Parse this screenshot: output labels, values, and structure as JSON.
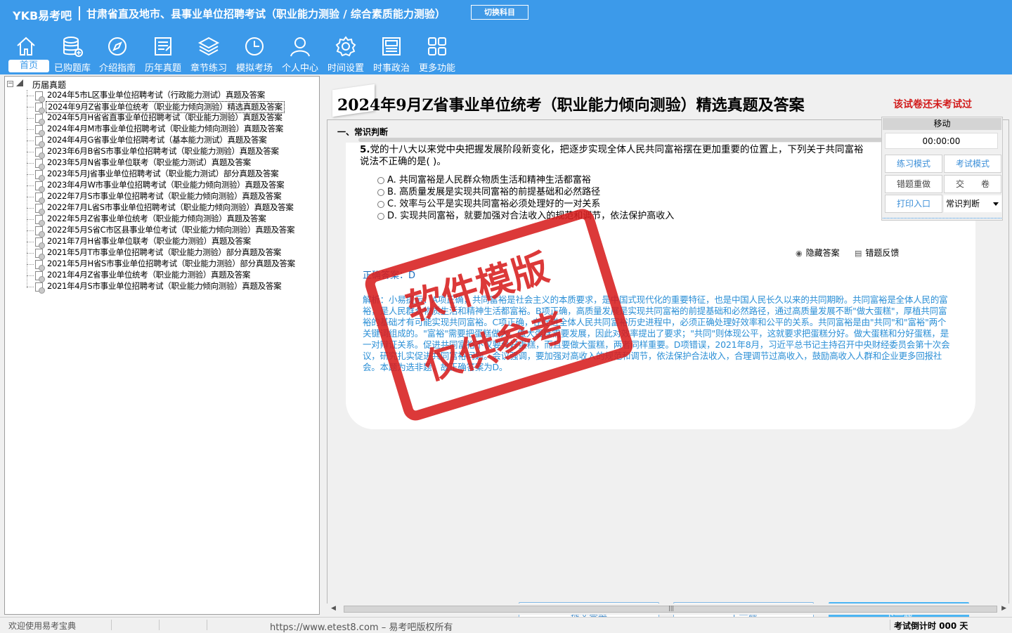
{
  "header": {
    "logo": "YKB易考吧",
    "title": "甘肃省直及地市、县事业单位招聘考试（职业能力测验 / 综合素质能力测验）",
    "switch_label": "切换科目"
  },
  "nav": [
    {
      "label": "首页",
      "icon": "home-icon",
      "active": true
    },
    {
      "label": "已购题库",
      "icon": "database-icon"
    },
    {
      "label": "介绍指南",
      "icon": "compass-icon"
    },
    {
      "label": "历年真题",
      "icon": "document-icon"
    },
    {
      "label": "章节练习",
      "icon": "layers-icon"
    },
    {
      "label": "模拟考场",
      "icon": "clock-icon"
    },
    {
      "label": "个人中心",
      "icon": "user-icon"
    },
    {
      "label": "时间设置",
      "icon": "gear-icon"
    },
    {
      "label": "时事政治",
      "icon": "newspaper-icon"
    },
    {
      "label": "更多功能",
      "icon": "grid-icon"
    }
  ],
  "tree": {
    "root": "历届真题",
    "items": [
      "2024年5市L区事业单位招聘考试（行政能力测试）真题及答案",
      "2024年9月Z省事业单位统考（职业能力倾向测验）精选真题及答案",
      "2024年5月H省省直事业单位招聘考试（职业能力测验）真题及答案",
      "2024年4月M市事业单位招聘考试（职业能力倾向测验）真题及答案",
      "2024年4月G省事业单位招聘考试（基本能力测试）真题及答案",
      "2023年6月B省S市事业单位招聘考试（职业能力测验）真题及答案",
      "2023年5月N省事业单位联考（职业能力测试）真题及答案",
      "2023年5月J省事业单位招聘考试（职业能力测试）部分真题及答案",
      "2023年4月W市事业单位招聘考试（职业能力倾向测验）真题及答案",
      "2022年7月S市事业单位招聘考试（职业能力倾向测验）真题及答案",
      "2022年7月L省S市事业单位招聘考试（职业能力倾向测验）真题及答案",
      "2022年5月Z省事业单位统考（职业能力倾向测验）真题及答案",
      "2022年5月S省C市区县事业单位考试（职业能力倾向测验）真题及答案",
      "2021年7月H省事业单位联考（职业能力测验）真题及答案",
      "2021年5月T市事业单位招聘考试（职业能力测验）部分真题及答案",
      "2021年5月H省S市事业单位招聘考试（职业能力测验）部分真题及答案",
      "2021年4月Z省事业单位统考（职业能力测验）真题及答案",
      "2021年4月S市事业单位招聘考试（职业能力倾向测验）真题及答案"
    ],
    "selected_index": 1
  },
  "exam": {
    "title": "2024年9月Z省事业单位统考（职业能力倾向测验）精选真题及答案",
    "status": "该试卷还未考试过",
    "section": "一、常识判断",
    "question_number": "5.",
    "question_text": "党的十八大以来党中央把握发展阶段新变化，把逐步实现全体人民共同富裕摆在更加重要的位置上，下列关于共同富裕说法不正确的是(  )。",
    "options": [
      "A. 共同富裕是人民群众物质生活和精神生活都富裕",
      "B. 高质量发展是实现共同富裕的前提基础和必然路径",
      "C. 效率与公平是实现共同富裕必须处理好的一对关系",
      "D. 实现共同富裕，就要加强对合法收入的规范和调节，依法保护高收入"
    ],
    "hide_answer_label": "隐藏答案",
    "feedback_label": "错题反馈",
    "correct_answer_label": "正确答案：",
    "correct_answer": "D",
    "analysis": "解析：小易提示：A项正确，共同富裕是社会主义的本质要求，是中国式现代化的重要特征，也是中国人民长久以来的共同期盼。共同富裕是全体人民的富裕，是人民群众物质生活和精神生活都富裕。B项正确，高质量发展是实现共同富裕的前提基础和必然路径，通过高质量发展不断\"做大蛋糕\"，厚植共同富裕的基础才有可能实现共同富裕。C项正确，在促进全体人民共同富裕历史进程中，必须正确处理好效率和公平的关系。共同富裕是由\"共同\"和\"富裕\"两个关键词组成的。\"富裕\"需要把蛋糕做大，做大蛋糕需要发展，因此对效率提出了要求；\"共同\"则体现公平，这就要求把蛋糕分好。做大蛋糕和分好蛋糕，是一对辩证关系。促进共同富裕不仅要分好蛋糕，而且要做大蛋糕，两者同样重要。D项错误，2021年8月，习近平总书记主持召开中央财经委员会第十次会议，研究扎实促进共同富裕问题。会议强调，要加强对高收入的规范和调节，依法保护合法收入，合理调节过高收入，鼓励高收入人群和企业更多回报社会。本题为选非题，故正确答案为D。",
    "buttons": {
      "submit": "提交答案",
      "prev": "上一题",
      "next": "下一题"
    }
  },
  "timer_panel": {
    "move_label": "移动",
    "time": "00:00:00",
    "practice_mode": "练习模式",
    "exam_mode": "考试模式",
    "redo_wrong": "错题重做",
    "submit_paper": "交　　卷",
    "print": "打印入口",
    "section_select": "常识判断"
  },
  "watermark": {
    "line1": "软件模版",
    "line2": "仅供参考"
  },
  "status_bar": {
    "welcome": "欢迎使用易考宝典",
    "url": "https://www.etest8.com – 易考吧版权所有",
    "countdown": "考试倒计时 000 天"
  },
  "colors": {
    "header_bg": "#3c9aea",
    "status_red": "#d21c1c",
    "analysis_blue": "#2b8fd6",
    "primary_button": "#4cb5f3"
  }
}
